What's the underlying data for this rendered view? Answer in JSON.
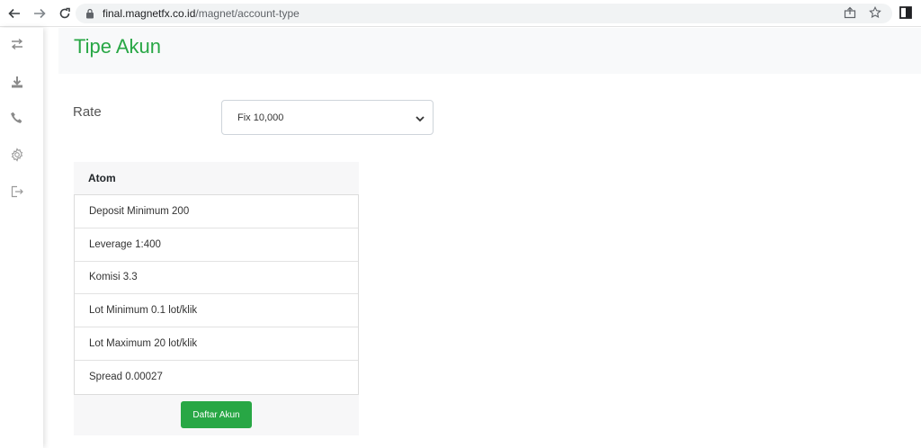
{
  "browser": {
    "url_host": "final.magnetfx.co.id",
    "url_path": "/magnet/account-type"
  },
  "page": {
    "title": "Tipe Akun"
  },
  "rate": {
    "label": "Rate",
    "selected": "Fix 10,000"
  },
  "card": {
    "header": "Atom",
    "items": [
      "Deposit Minimum 200",
      "Leverage 1:400",
      "Komisi 3.3",
      "Lot Minimum 0.1 lot/klik",
      "Lot Maximum 20 lot/klik",
      "Spread 0.00027"
    ],
    "button_label": "Daftar Akun"
  },
  "colors": {
    "accent": "#28a745",
    "header_bg": "#f8f9fa",
    "card_bg": "#f7f7f8"
  },
  "icons": {
    "sidebar": [
      "swap-icon",
      "download-icon",
      "phone-icon",
      "gear-icon",
      "logout-icon"
    ]
  }
}
